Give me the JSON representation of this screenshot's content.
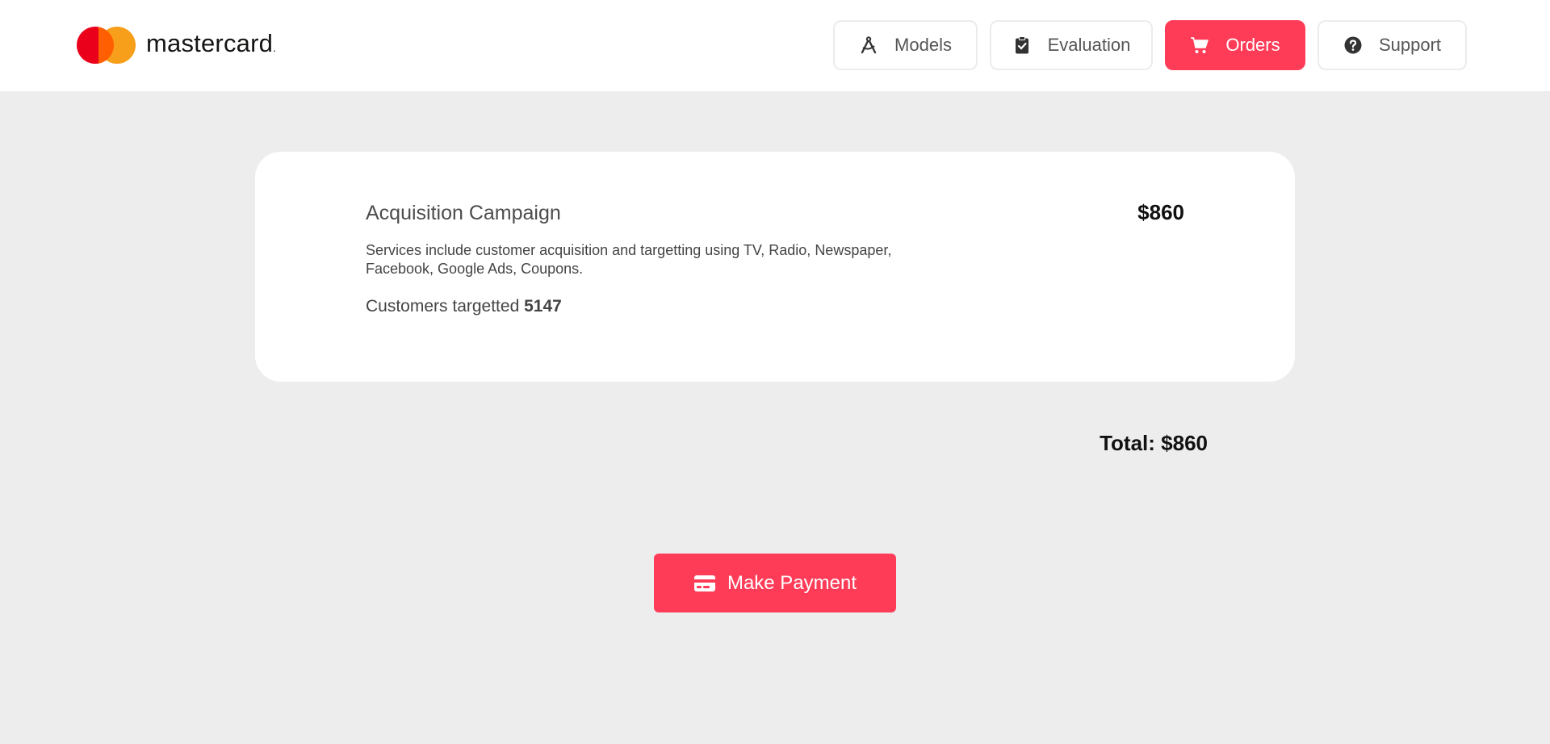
{
  "brand": {
    "name": "mastercard",
    "dot": ".",
    "colors": {
      "red": "#eb001b",
      "orange": "#f79e1b",
      "accent": "#ff3c58"
    }
  },
  "nav": {
    "items": [
      {
        "label": "Models",
        "icon": "compass-drafting-icon",
        "active": false
      },
      {
        "label": "Evaluation",
        "icon": "clipboard-check-icon",
        "active": false
      },
      {
        "label": "Orders",
        "icon": "cart-icon",
        "active": true
      },
      {
        "label": "Support",
        "icon": "question-circle-icon",
        "active": false
      }
    ]
  },
  "order": {
    "title": "Acquisition Campaign",
    "price": "$860",
    "description": "Services include customer acquisition and targetting using TV, Radio, Newspaper, Facebook, Google Ads, Coupons.",
    "customers_label": "Customers targetted",
    "customers_value": "5147"
  },
  "summary": {
    "total": "Total: $860"
  },
  "payment": {
    "label": "Make Payment",
    "icon": "credit-card-icon"
  }
}
